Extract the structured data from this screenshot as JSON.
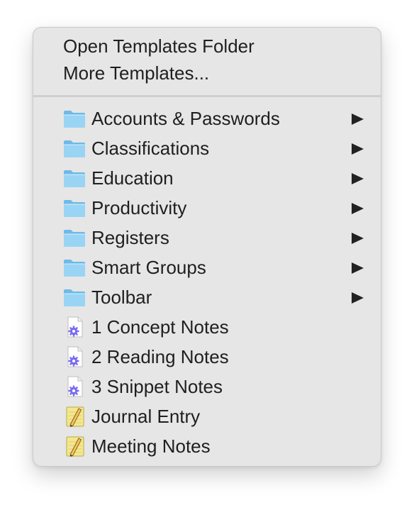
{
  "menu": {
    "top_items": [
      {
        "label": "Open Templates Folder"
      },
      {
        "label": "More Templates..."
      }
    ],
    "folders": [
      {
        "label": "Accounts & Passwords",
        "icon": "folder-icon"
      },
      {
        "label": "Classifications",
        "icon": "folder-icon"
      },
      {
        "label": "Education",
        "icon": "folder-icon"
      },
      {
        "label": "Productivity",
        "icon": "folder-icon"
      },
      {
        "label": "Registers",
        "icon": "folder-icon"
      },
      {
        "label": "Smart Groups",
        "icon": "folder-icon"
      },
      {
        "label": "Toolbar",
        "icon": "folder-icon"
      }
    ],
    "templates": [
      {
        "label": "1 Concept Notes",
        "icon": "script-document-icon"
      },
      {
        "label": "2 Reading Notes",
        "icon": "script-document-icon"
      },
      {
        "label": "3 Snippet Notes",
        "icon": "script-document-icon"
      },
      {
        "label": "Journal Entry",
        "icon": "notepad-icon"
      },
      {
        "label": "Meeting Notes",
        "icon": "notepad-icon"
      }
    ],
    "colors": {
      "folder": "#8fcdf2",
      "gear": "#7a6cf0",
      "notepad": "#f2e58a"
    }
  }
}
